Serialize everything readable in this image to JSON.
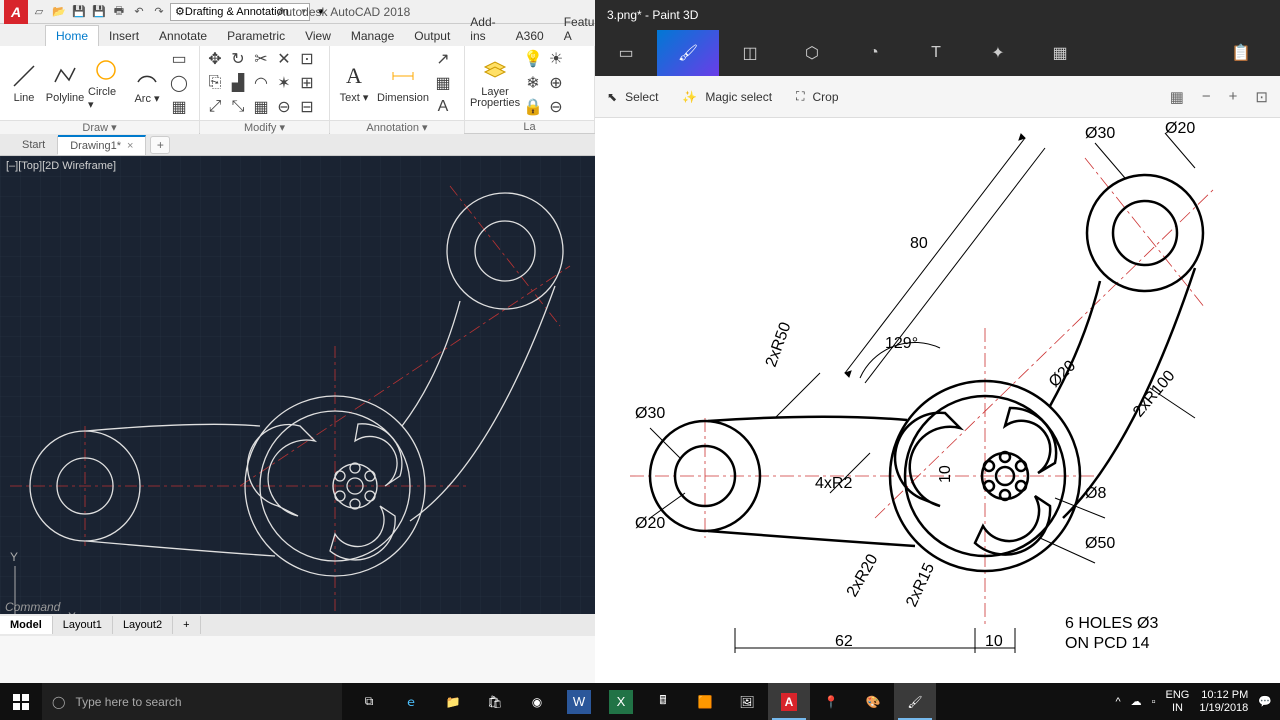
{
  "acad": {
    "title": "Autodesk AutoCAD 2018",
    "workspace": "Drafting & Annotation",
    "tabs": [
      "Home",
      "Insert",
      "Annotate",
      "Parametric",
      "View",
      "Manage",
      "Output",
      "Add-ins",
      "A360",
      "Featured A"
    ],
    "panels": {
      "draw": {
        "title": "Draw ▾",
        "tools": {
          "line": "Line",
          "polyline": "Polyline",
          "circle": "Circle ▾",
          "arc": "Arc ▾"
        }
      },
      "modify": {
        "title": "Modify ▾"
      },
      "annotation": {
        "title": "Annotation ▾",
        "tools": {
          "text": "Text ▾",
          "dim": "Dimension"
        }
      },
      "layers": {
        "title": "La",
        "tool": "Layer\nProperties"
      }
    },
    "doctabs": {
      "start": "Start",
      "drawing": "Drawing1*"
    },
    "viewport_label": "[–][Top][2D Wireframe]",
    "command": "Command",
    "layout_tabs": [
      "Model",
      "Layout1",
      "Layout2"
    ],
    "ucs": {
      "y": "Y",
      "x": "X"
    }
  },
  "p3d": {
    "title": "3.png* - Paint 3D",
    "sub": {
      "select": "Select",
      "magic": "Magic select",
      "crop": "Crop"
    },
    "dims": {
      "d30a": "Ø30",
      "d20a": "Ø20",
      "len80": "80",
      "ang129": "129°",
      "r50": "2xR50",
      "d30b": "Ø30",
      "d20b": "Ø20",
      "r2": "4xR2",
      "ten": "10",
      "d20c": "Ø20",
      "r100": "2xR100",
      "d8": "Ø8",
      "d50": "Ø50",
      "r20": "2xR20",
      "r15": "2xR15",
      "len62": "62",
      "len10": "10",
      "holes1": "6 HOLES Ø3",
      "holes2": "ON PCD 14"
    }
  },
  "taskbar": {
    "search_placeholder": "Type here to search",
    "lang1": "ENG",
    "lang2": "IN",
    "time": "10:12 PM",
    "date": "1/19/2018"
  }
}
